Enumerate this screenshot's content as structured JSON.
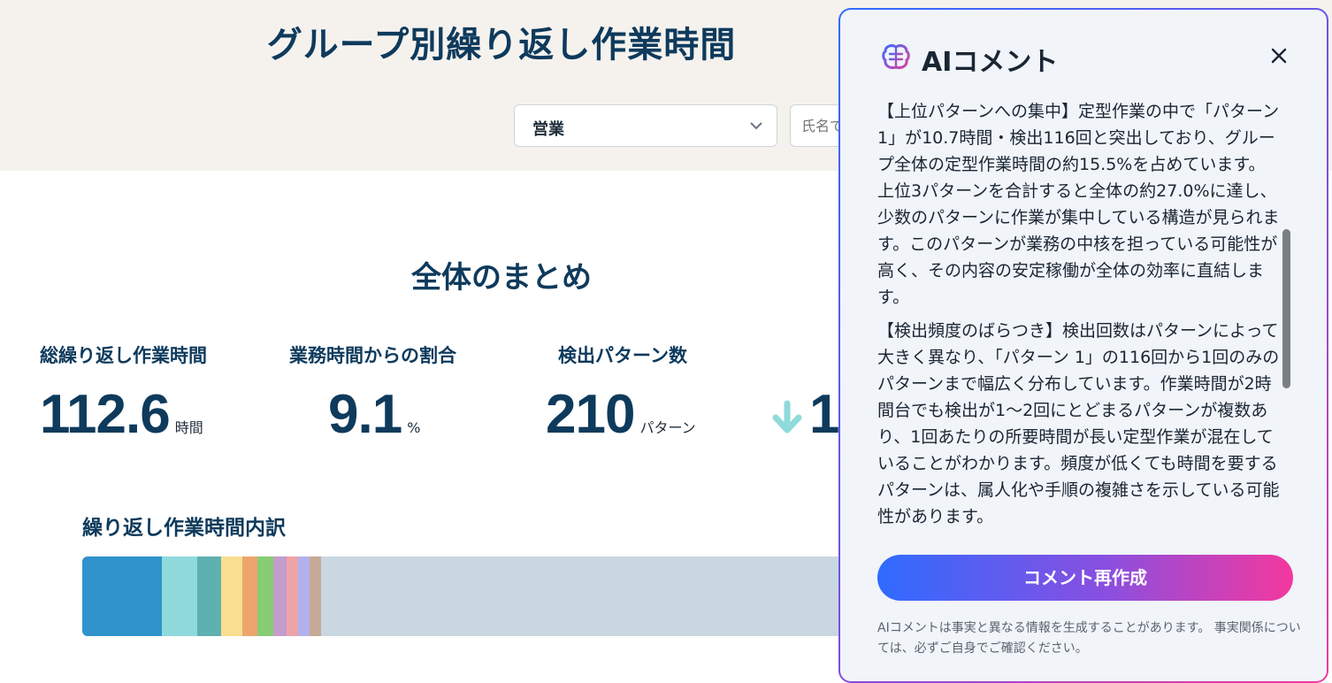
{
  "header": {
    "title": "グループ別繰り返し作業時間",
    "group_select": {
      "value": "営業"
    },
    "name_input": {
      "placeholder": "氏名で"
    }
  },
  "summary": {
    "title": "全体のまとめ",
    "metrics": [
      {
        "label": "総繰り返し作業時間",
        "value": "112.6",
        "unit": "時間"
      },
      {
        "label": "業務時間からの割合",
        "value": "9.1",
        "unit": "%"
      },
      {
        "label": "検出パターン数",
        "value": "210",
        "unit": "パターン"
      },
      {
        "value": "1",
        "trend": "down"
      }
    ]
  },
  "breakdown": {
    "title": "繰り返し作業時間内訳",
    "segments": [
      {
        "color": "#3193cc",
        "share": 0.103
      },
      {
        "color": "#8fdadb",
        "share": 0.046
      },
      {
        "color": "#5fb0b0",
        "share": 0.031
      },
      {
        "color": "#f8de8e",
        "share": 0.028
      },
      {
        "color": "#eda56d",
        "share": 0.02
      },
      {
        "color": "#88cc75",
        "share": 0.02
      },
      {
        "color": "#c39dcc",
        "share": 0.017
      },
      {
        "color": "#eda4a8",
        "share": 0.015
      },
      {
        "color": "#b3b0ed",
        "share": 0.015
      },
      {
        "color": "#c5aa98",
        "share": 0.015
      }
    ]
  },
  "ai_panel": {
    "title": "AIコメント",
    "paragraphs": [
      "【上位パターンへの集中】定型作業の中で「パターン 1」が10.7時間・検出116回と突出しており、グループ全体の定型作業時間の約15.5%を占めています。上位3パターンを合計すると全体の約27.0%に達し、少数のパターンに作業が集中している構造が見られます。このパターンが業務の中核を担っている可能性が高く、その内容の安定稼働が全体の効率に直結します。",
      "【検出頻度のばらつき】検出回数はパターンによって大きく異なり、「パターン 1」の116回から1回のみのパターンまで幅広く分布しています。作業時間が2時間台でも検出が1〜2回にとどまるパターンが複数あり、1回あたりの所要時間が長い定型作業が混在していることがわかります。頻度が低くても時間を要するパターンは、属人化や手順の複雑さを示している可能性があります。"
    ],
    "regenerate_label": "コメント再作成",
    "disclaimer": "AIコメントは事実と異なる情報を生成することがあります。 事実関係については、必ずご自身でご確認ください。"
  }
}
